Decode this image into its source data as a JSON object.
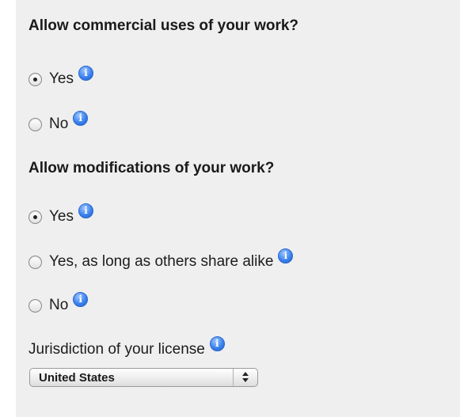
{
  "commercial": {
    "question": "Allow commercial uses of your work?",
    "options": [
      {
        "label": "Yes",
        "selected": true,
        "info_icon": "info-icon"
      },
      {
        "label": "No",
        "selected": false,
        "info_icon": "info-icon"
      }
    ]
  },
  "modifications": {
    "question": "Allow modifications of your work?",
    "options": [
      {
        "label": "Yes",
        "selected": true,
        "info_icon": "info-icon"
      },
      {
        "label": "Yes, as long as others share alike",
        "selected": false,
        "info_icon": "info-icon"
      },
      {
        "label": "No",
        "selected": false,
        "info_icon": "info-icon"
      }
    ]
  },
  "jurisdiction": {
    "label": "Jurisdiction of your license",
    "selected": "United States",
    "info_icon": "info-icon"
  },
  "colors": {
    "panel_bg": "#efefef",
    "info_icon_blue": "#3c83ef"
  }
}
